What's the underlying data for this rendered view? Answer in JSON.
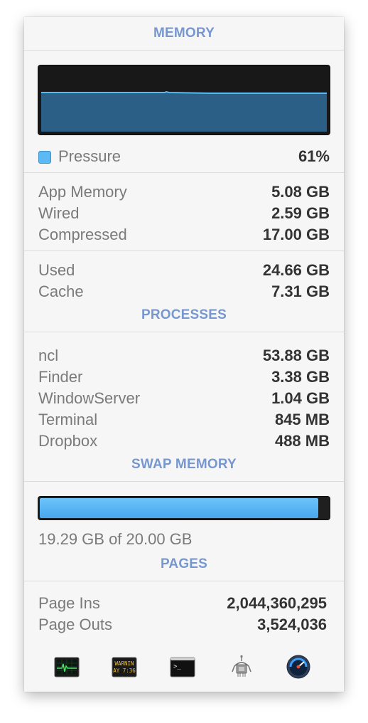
{
  "sections": {
    "memory": "MEMORY",
    "processes": "PROCESSES",
    "swap": "SWAP MEMORY",
    "pages": "PAGES"
  },
  "pressure": {
    "label": "Pressure",
    "value": "61%",
    "color": "#5bb9f4"
  },
  "memory_breakdown": [
    {
      "label": "App Memory",
      "value": "5.08 GB"
    },
    {
      "label": "Wired",
      "value": "2.59 GB"
    },
    {
      "label": "Compressed",
      "value": "17.00 GB"
    }
  ],
  "memory_totals": [
    {
      "label": "Used",
      "value": "24.66 GB"
    },
    {
      "label": "Cache",
      "value": "7.31 GB"
    }
  ],
  "processes": [
    {
      "label": "ncl",
      "value": "53.88 GB"
    },
    {
      "label": "Finder",
      "value": "3.38 GB"
    },
    {
      "label": "WindowServer",
      "value": "1.04 GB"
    },
    {
      "label": "Terminal",
      "value": "845 MB"
    },
    {
      "label": "Dropbox",
      "value": "488 MB"
    }
  ],
  "swap": {
    "text": "19.29 GB of 20.00 GB",
    "used_fraction": 0.9645
  },
  "pages": [
    {
      "label": "Page Ins",
      "value": "2,044,360,295"
    },
    {
      "label": "Page Outs",
      "value": "3,524,036"
    }
  ],
  "toolbar": {
    "icons": [
      "activity-monitor-icon",
      "console-icon",
      "terminal-icon",
      "system-information-icon",
      "disk-utility-icon"
    ],
    "console_text": [
      "WARNIN",
      "AY 7:36"
    ]
  },
  "colors": {
    "accent": "#7797d0",
    "graph_fill": "#2b5f86",
    "graph_line": "#5bb9f4"
  }
}
